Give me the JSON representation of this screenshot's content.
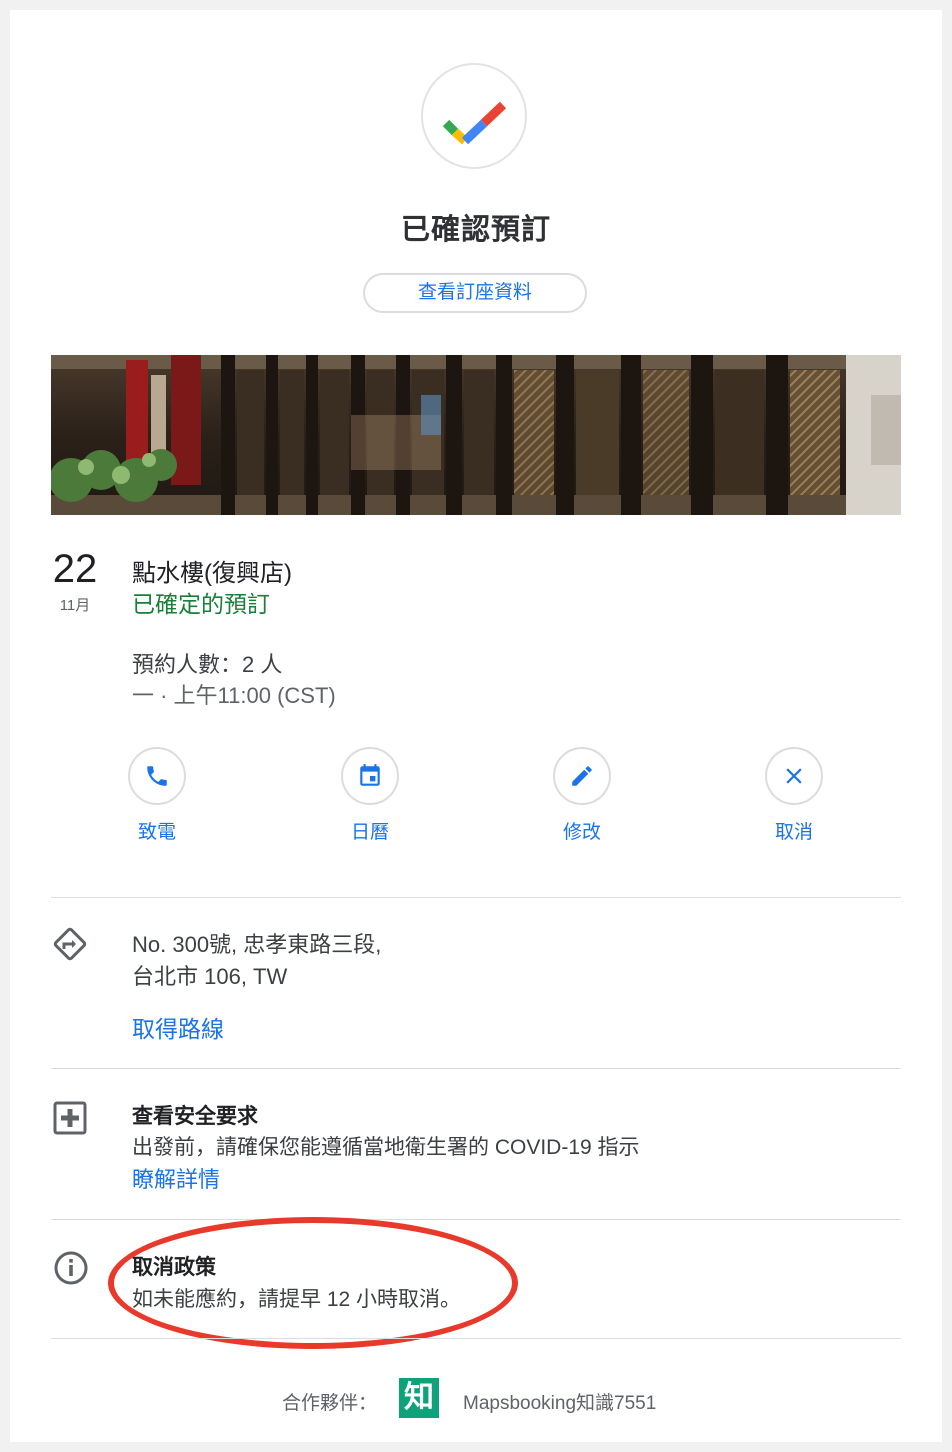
{
  "header": {
    "title": "已確認預訂",
    "view_button": "查看訂座資料"
  },
  "booking": {
    "day": "22",
    "month": "11月",
    "restaurant": "點水樓(復興店)",
    "status": "已確定的預訂",
    "party": "預約人數：2 人",
    "time": "一 · 上午11:00 (CST)"
  },
  "actions": [
    {
      "label": "致電",
      "icon": "phone-icon"
    },
    {
      "label": "日曆",
      "icon": "calendar-icon"
    },
    {
      "label": "修改",
      "icon": "edit-pencil-icon"
    },
    {
      "label": "取消",
      "icon": "close-icon"
    }
  ],
  "address": {
    "line1": "No. 300號, 忠孝東路三段,",
    "line2": "台北市 106, TW",
    "directions_link": "取得路線"
  },
  "safety": {
    "title": "查看安全要求",
    "description": "出發前，請確保您能遵循當地衛生署的 COVID-19 指示",
    "link": "瞭解詳情"
  },
  "policy": {
    "title": "取消政策",
    "description": "如未能應約，請提早 12 小時取消。"
  },
  "partner": {
    "label": "合作夥伴：",
    "logo_text": "知",
    "name": "Mapsbooking知識7551"
  },
  "colors": {
    "accent_blue": "#1a73e8",
    "confirmed_green": "#188038",
    "highlight_red": "#e8392b"
  }
}
